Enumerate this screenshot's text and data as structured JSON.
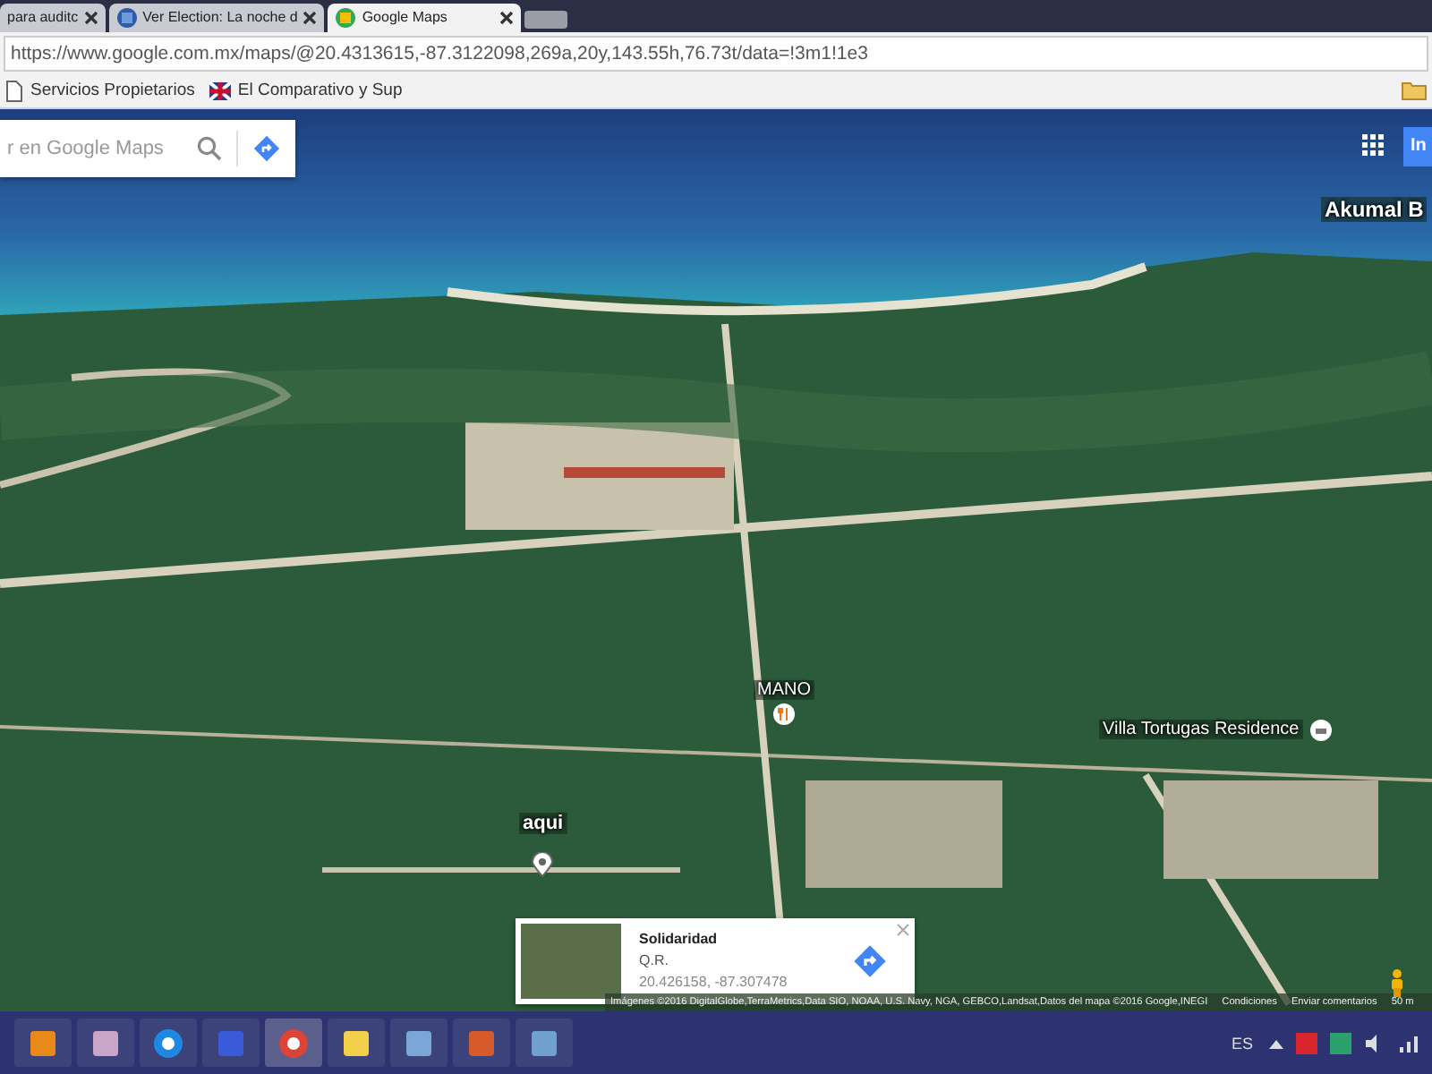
{
  "browser": {
    "tabs": [
      {
        "label": "para auditc",
        "selected": false
      },
      {
        "label": "Ver Election: La noche d",
        "selected": false
      },
      {
        "label": "Google Maps",
        "selected": true
      }
    ],
    "address": "https://www.google.com.mx/maps/@20.4313615,-87.3122098,269a,20y,143.55h,76.73t/data=!3m1!1e3",
    "bookmarks": [
      "Servicios Propietarios",
      "El Comparativo y Sup"
    ]
  },
  "map": {
    "search": {
      "placeholder": "r en Google Maps"
    },
    "signin_button": "In",
    "labels": [
      {
        "text": "Akumal B",
        "kind": "area"
      },
      {
        "text": "MANO",
        "kind": "restaurant"
      },
      {
        "text": "Villa Tortugas Residence",
        "kind": "hotel"
      },
      {
        "text": "aqui",
        "kind": "marker"
      }
    ],
    "info_card": {
      "title": "Solidaridad",
      "subtitle": "Q.R.",
      "coordinates": "20.426158, -87.307478"
    },
    "attribution": "Imágenes ©2016 DigitalGlobe,TerraMetrics,Data SIO, NOAA, U.S. Navy, NGA, GEBCO,Landsat,Datos del mapa ©2016 Google,INEGI",
    "footer_links": [
      "Condiciones",
      "Enviar comentarios"
    ],
    "scale": "50 m"
  },
  "taskbar": {
    "language": "ES"
  }
}
